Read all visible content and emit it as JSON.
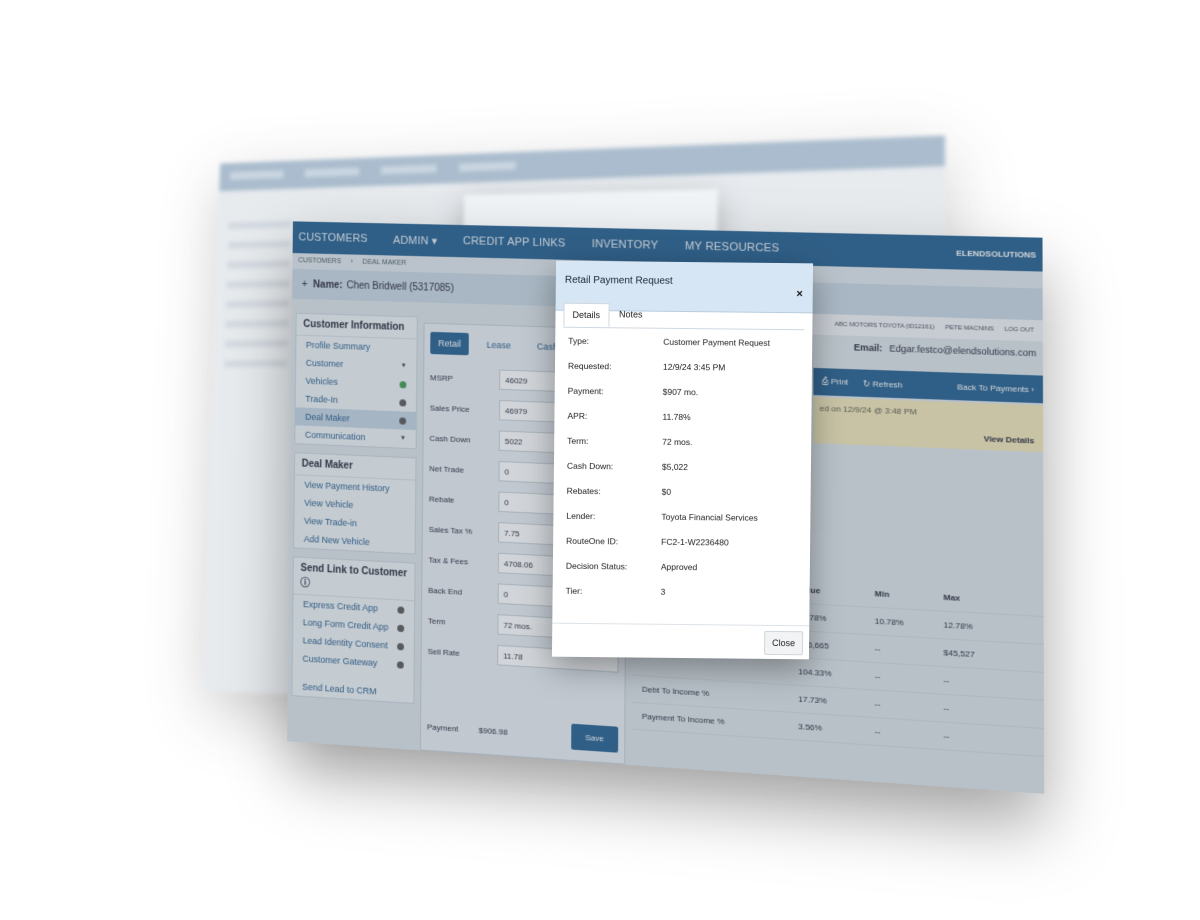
{
  "app": {
    "nav": [
      "CUSTOMERS",
      "ADMIN ▾",
      "CREDIT APP LINKS",
      "INVENTORY",
      "MY RESOURCES"
    ],
    "logo": "ELENDSOLUTIONS",
    "breadcrumbs": [
      "CUSTOMERS",
      "DEAL MAKER"
    ],
    "name_label": "Name:",
    "customer_name": "Chen Bridwell (5317085)",
    "dealer_info": [
      "ABC MOTORS TOYOTA (ID12161)",
      "PETE MACNINS",
      "LOG OUT"
    ],
    "email_label": "Email:",
    "email": "Edgar.festco@elendsolutions.com"
  },
  "sidebar": {
    "customer_info": {
      "title": "Customer Information",
      "items": [
        {
          "label": "Profile Summary"
        },
        {
          "label": "Customer",
          "marker": "caret"
        },
        {
          "label": "Vehicles",
          "marker": "ok"
        },
        {
          "label": "Trade-In",
          "marker": "dot"
        },
        {
          "label": "Deal Maker",
          "marker": "dot"
        },
        {
          "label": "Communication",
          "marker": "caret"
        }
      ]
    },
    "deal_maker": {
      "title": "Deal Maker",
      "items": [
        "View Payment History",
        "View Vehicle",
        "View Trade-in",
        "Add New Vehicle"
      ]
    },
    "send_link": {
      "title": "Send Link to Customer",
      "items": [
        "Express Credit App",
        "Long Form Credit App",
        "Lead Identity Consent",
        "Customer Gateway"
      ],
      "footer": "Send Lead to CRM"
    }
  },
  "form": {
    "tabs": [
      "Retail",
      "Lease",
      "Cash"
    ],
    "fields": [
      {
        "label": "MSRP",
        "value": "46029"
      },
      {
        "label": "Sales Price",
        "value": "46979"
      },
      {
        "label": "Cash Down",
        "value": "5022"
      },
      {
        "label": "Net Trade",
        "value": "0"
      },
      {
        "label": "Rebate",
        "value": "0"
      },
      {
        "label": "Sales Tax %",
        "value": "7.75"
      },
      {
        "label": "Tax & Fees",
        "value": "4708.06"
      },
      {
        "label": "Back End",
        "value": "0"
      },
      {
        "label": "Term",
        "value": "72 mos."
      },
      {
        "label": "Sell Rate",
        "value": "11.78"
      }
    ],
    "payment_label": "Payment",
    "payment_value": "$906.98",
    "save_label": "Save"
  },
  "right": {
    "print": "Print",
    "refresh": "Refresh",
    "back": "Back To Payments",
    "note": "ed on 12/9/24 @ 3:48 PM",
    "view_details": "View Details",
    "table": {
      "headers": [
        "",
        "Value",
        "Min",
        "Max"
      ],
      "rows": [
        [
          "",
          "11.78%",
          "10.78%",
          "12.78%"
        ],
        [
          "",
          "$46,665",
          "--",
          "$45,527"
        ],
        [
          "",
          "104.33%",
          "--",
          "--"
        ],
        [
          "Debt To Income %",
          "17.73%",
          "--",
          "--"
        ],
        [
          "Payment To Income %",
          "3.56%",
          "--",
          "--"
        ]
      ]
    }
  },
  "modal": {
    "title": "Retail Payment Request",
    "close_x": "×",
    "tabs": [
      "Details",
      "Notes"
    ],
    "details": [
      {
        "k": "Type:",
        "v": "Customer Payment Request"
      },
      {
        "k": "Requested:",
        "v": "12/9/24 3:45 PM"
      },
      {
        "k": "Payment:",
        "v": "$907 mo."
      },
      {
        "k": "APR:",
        "v": "11.78%"
      },
      {
        "k": "Term:",
        "v": "72 mos."
      },
      {
        "k": "Cash Down:",
        "v": "$5,022"
      },
      {
        "k": "Rebates:",
        "v": "$0"
      },
      {
        "k": "Lender:",
        "v": "Toyota Financial Services"
      },
      {
        "k": "RouteOne ID:",
        "v": "FC2-1-W2236480"
      },
      {
        "k": "Decision Status:",
        "v": "Approved"
      },
      {
        "k": "Tier:",
        "v": "3"
      }
    ],
    "close_label": "Close"
  }
}
